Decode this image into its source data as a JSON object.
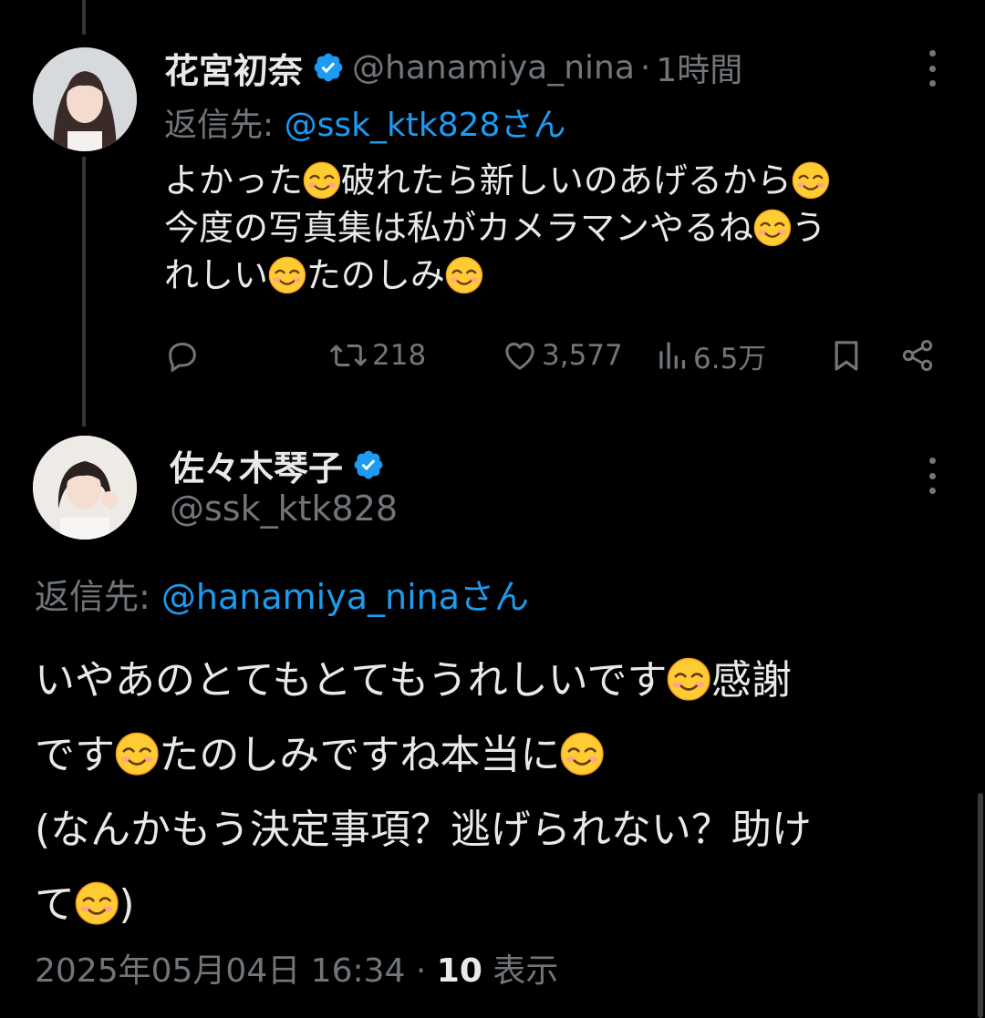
{
  "tweet1": {
    "display_name": "花宮初奈",
    "handle": "@hanamiya_nina",
    "separator": "·",
    "time": "1時間",
    "reply_prefix": "返信先: ",
    "reply_mention": "@ssk_ktk828さん",
    "lines": [
      [
        "よかった",
        "emoji",
        "破れたら新しいのあげるから",
        "emoji"
      ],
      [
        "今度の写真集は私がカメラマンやるね",
        "emoji",
        "う"
      ],
      [
        "れしい",
        "emoji",
        "たのしみ",
        "emoji"
      ]
    ],
    "line1_a": "よかった",
    "line1_b": "破れたら新しいのあげるから",
    "line2_a": "今度の写真集は私がカメラマンやるね",
    "line2_b": "う",
    "line3_a": "れしい",
    "line3_b": "たのしみ",
    "retweets": "218",
    "likes": "3,577",
    "views": "6.5万"
  },
  "tweet2": {
    "display_name": "佐々木琴子",
    "handle": "@ssk_ktk828",
    "reply_prefix": "返信先: ",
    "reply_mention": "@hanamiya_ninaさん",
    "line1_a": "いやあのとてもとてもうれしいです",
    "line1_b": "感謝",
    "line2_a": "です",
    "line2_b": "たのしみですね本当に",
    "line3": "(なんかもう決定事項？逃げられない？助け",
    "line4_a": "て",
    "line4_b": ")",
    "timestamp": "2025年05月04日 16:34",
    "separator": "·",
    "view_count": "10",
    "view_label": "表示"
  },
  "icons": {
    "verified": "verified-badge-icon",
    "reply": "reply-icon",
    "retweet": "retweet-icon",
    "like": "heart-icon",
    "views": "views-icon",
    "bookmark": "bookmark-icon",
    "share": "share-icon",
    "emoji": "smiling-face-emoji"
  },
  "colors": {
    "background": "#000000",
    "text": "#e7e9ea",
    "secondary": "#71767b",
    "link": "#1d9bf0",
    "verified": "#1d9bf0"
  }
}
